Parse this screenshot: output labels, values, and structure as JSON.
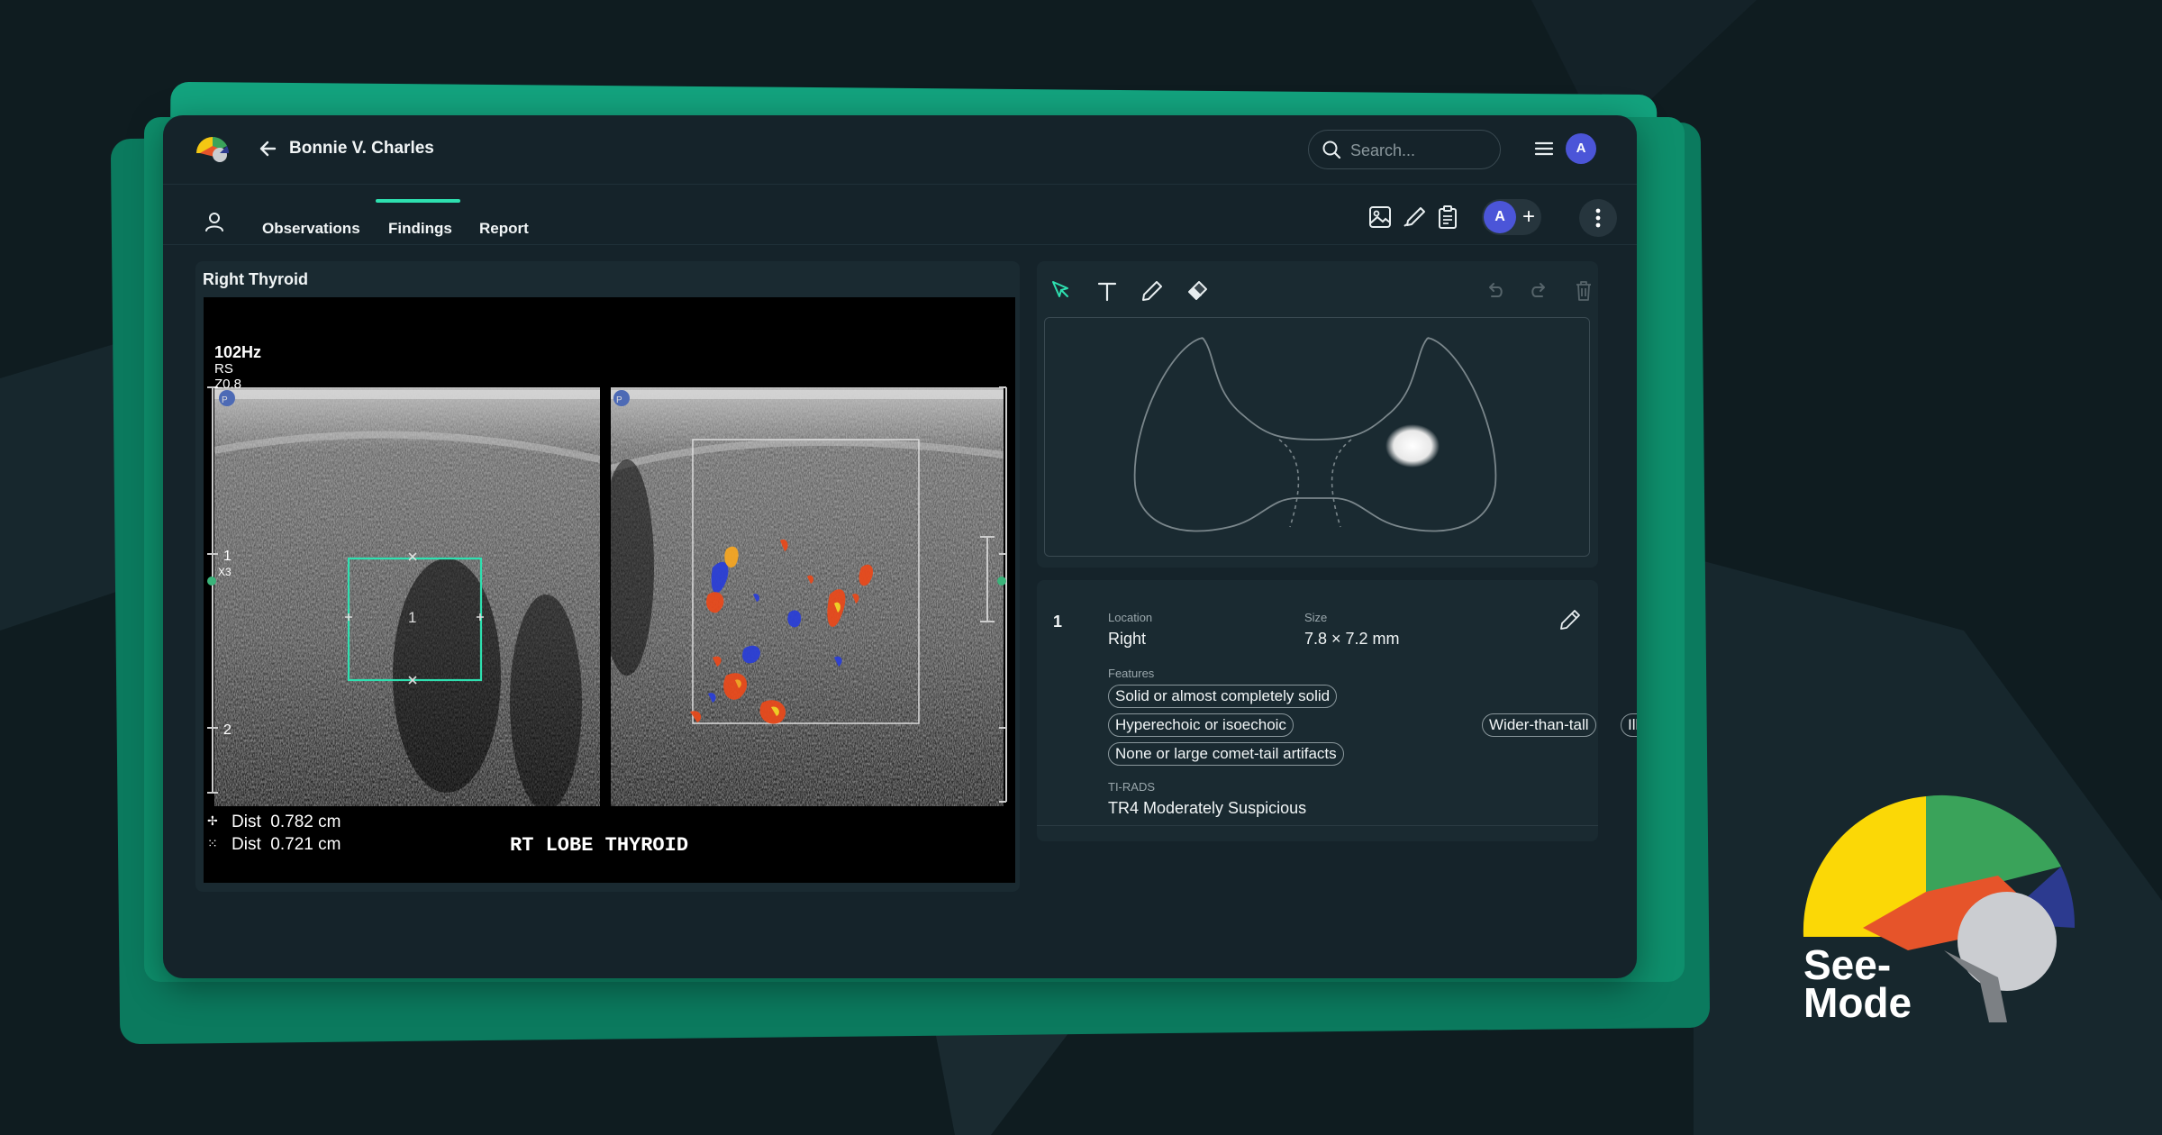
{
  "header": {
    "patient_name": "Bonnie V. Charles",
    "search_placeholder": "Search...",
    "user_initial": "A"
  },
  "tabs": [
    {
      "label": "Observations",
      "active": false
    },
    {
      "label": "Findings",
      "active": true
    },
    {
      "label": "Report",
      "active": false
    }
  ],
  "toolbar": {
    "collaborator_initial": "A",
    "add_label": "+"
  },
  "image_panel": {
    "title": "Right Thyroid",
    "overlay": {
      "freq": "102Hz",
      "rs": "RS",
      "zoom": "Z0.8",
      "scale_1": "1",
      "scale_2": "2",
      "x3": "X3",
      "nodule_label": "1",
      "dist1": "Dist  0.782 cm",
      "dist2": "Dist  0.721 cm",
      "caption": "RT LOBE THYROID"
    }
  },
  "finding": {
    "number": "1",
    "location_label": "Location",
    "location_value": "Right",
    "size_label": "Size",
    "size_value": "7.8 × 7.2 mm",
    "features_label": "Features",
    "features": [
      "Solid or almost completely solid",
      "Hyperechoic or isoechoic",
      "Wider-than-tall",
      "Ill defined",
      "None or large comet-tail artifacts"
    ],
    "tirads_label": "TI-RADS",
    "tirads_value": "TR4 Moderately Suspicious"
  },
  "brand": {
    "line1": "See-",
    "line2": "Mode"
  },
  "colors": {
    "accent": "#2ee0b0",
    "avatar": "#4b55d8",
    "green_frame": "#13a37e"
  }
}
